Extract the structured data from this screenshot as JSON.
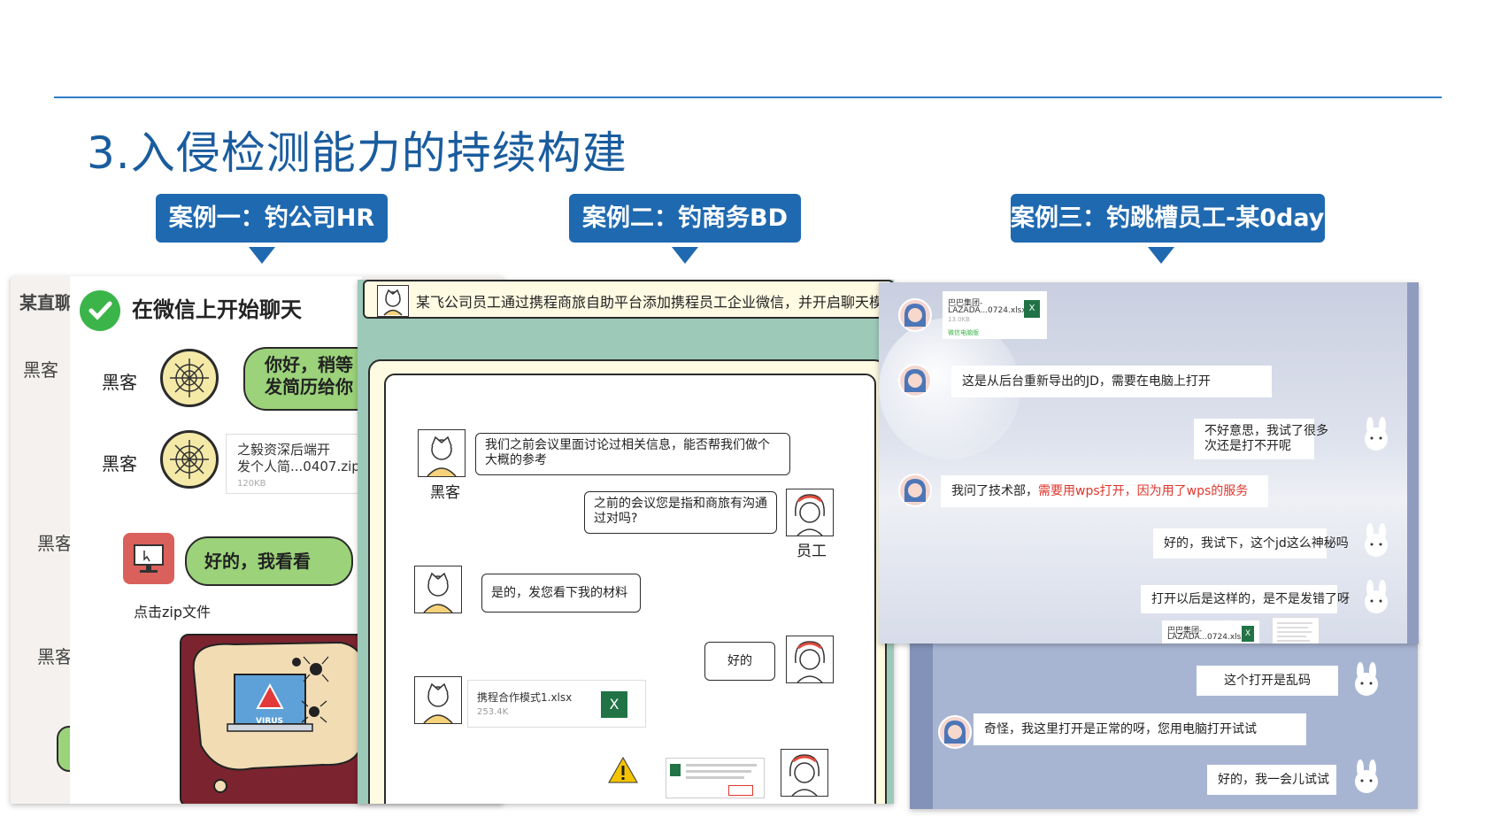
{
  "slide": {
    "title": "3.入侵检测能力的持续构建"
  },
  "cases": [
    {
      "label": "案例一：钓公司HR"
    },
    {
      "label": "案例二：钓商务BD"
    },
    {
      "label": "案例三：钓跳槽员工-某0day!"
    }
  ],
  "panel1": {
    "back_title": "某直聊",
    "back_labels": [
      "黑客",
      "黑客",
      "黑客"
    ],
    "header": "在微信上开始聊天",
    "hacker_label": "黑客",
    "bubble1": [
      "你好，稍等",
      "发简历给你"
    ],
    "file_card": {
      "name_line1": "之毅资深后端开",
      "name_line2": "发个人简...0407.zip",
      "size": "120KB"
    },
    "bubble2": "好的，我看看",
    "click_caption": "点击zip文件",
    "virus_text": "VIRUS"
  },
  "panel2": {
    "banner": "某飞公司员工通过携程商旅自助平台添加携程员工企业微信，并开启聊天模式",
    "hacker_label": "黑客",
    "employee_label": "员工",
    "msg1": "我们之前会议里面讨论过相关信息，能否帮我们做个大概的参考",
    "msg2": "之前的会议您是指和商旅有沟通过对吗?",
    "msg3": "是的，发您看下我的材料",
    "msg4": "好的",
    "file_name": "携程合作模式1.xlsx",
    "file_size": "253.4K",
    "excel_letter": "X"
  },
  "panel3": {
    "file_card1": {
      "line1": "巴巴集团-",
      "line2": "LAZADA...0724.xlsx",
      "size": "13.0KB",
      "source": "微信电脑版"
    },
    "msg1": "这是从后台重新导出的JD，需要在电脑上打开",
    "msg2_line1": "不好意思，我试了很多",
    "msg2_line2": "次还是打不开呢",
    "msg3_prefix": "我问了技术部，",
    "msg3_highlight": "需要用wps打开，因为用了wps的服务",
    "msg4": "好的，我试下，这个jd这么神秘吗",
    "msg5": "打开以后是这样的，是不是发错了呀",
    "file_card2": {
      "line1": "巴巴集团-",
      "line2": "LAZADA...0724.xlsx"
    },
    "msg6": "这个打开是乱码",
    "msg7": "奇怪，我这里打开是正常的呀，您用电脑打开试试",
    "msg8": "好的，我一会儿试试",
    "excel_letter": "X"
  },
  "colors": {
    "accent": "#1f69b0",
    "title": "#1a5c9e",
    "highlight": "#e0352b",
    "wechat_green": "#3bb54a",
    "bubble_green": "#9bd27a",
    "panel2_bg": "#9dc9b9"
  }
}
